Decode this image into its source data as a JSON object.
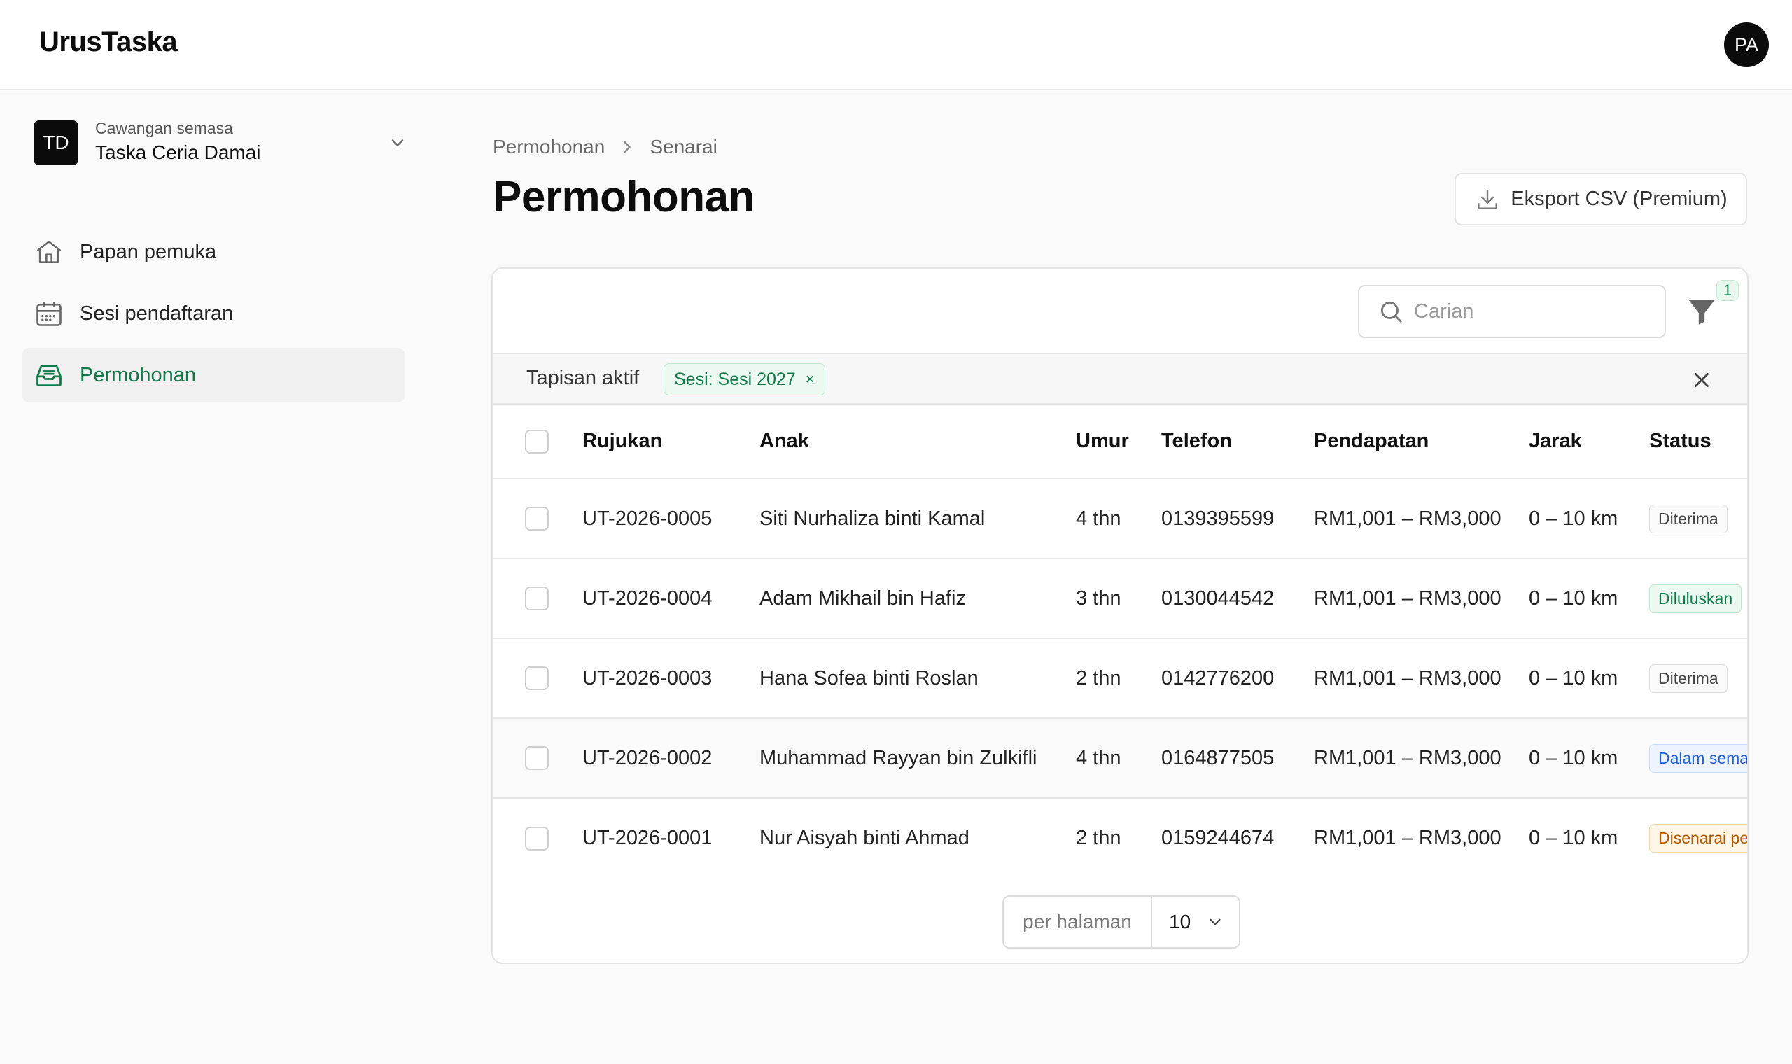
{
  "app": {
    "title": "UrusTaska",
    "user_initials": "PA"
  },
  "branch": {
    "initials": "TD",
    "caption": "Cawangan semasa",
    "name": "Taska Ceria Damai"
  },
  "sidebar": {
    "items": [
      {
        "label": "Papan pemuka",
        "icon": "home-icon"
      },
      {
        "label": "Sesi pendaftaran",
        "icon": "calendar-icon"
      },
      {
        "label": "Permohonan",
        "icon": "inbox-icon",
        "active": true
      }
    ]
  },
  "breadcrumb": {
    "parent": "Permohonan",
    "current": "Senarai"
  },
  "page": {
    "title": "Permohonan",
    "export_label": "Eksport CSV (Premium)"
  },
  "search": {
    "placeholder": "Carian"
  },
  "filters": {
    "count": "1",
    "label": "Tapisan aktif",
    "chips": [
      {
        "label": "Sesi: Sesi 2027",
        "remove": "×"
      }
    ]
  },
  "table": {
    "columns": [
      "Rujukan",
      "Anak",
      "Umur",
      "Telefon",
      "Pendapatan",
      "Jarak",
      "Status"
    ],
    "rows": [
      {
        "ref": "UT-2026-0005",
        "child": "Siti Nurhaliza binti Kamal",
        "age": "4 thn",
        "phone": "0139395599",
        "income": "RM1,001 – RM3,000",
        "distance": "0 – 10 km",
        "status": "Diterima",
        "status_color": "#444444"
      },
      {
        "ref": "UT-2026-0004",
        "child": "Adam Mikhail bin Hafiz",
        "age": "3 thn",
        "phone": "0130044542",
        "income": "RM1,001 – RM3,000",
        "distance": "0 – 10 km",
        "status": "Diluluskan",
        "status_color": "#0f7a4a"
      },
      {
        "ref": "UT-2026-0003",
        "child": "Hana Sofea binti Roslan",
        "age": "2 thn",
        "phone": "0142776200",
        "income": "RM1,001 – RM3,000",
        "distance": "0 – 10 km",
        "status": "Diterima",
        "status_color": "#444444"
      },
      {
        "ref": "UT-2026-0002",
        "child": "Muhammad Rayyan bin Zulkifli",
        "age": "4 thn",
        "phone": "0164877505",
        "income": "RM1,001 – RM3,000",
        "distance": "0 – 10 km",
        "status": "Dalam sema",
        "status_color": "#1f5fd0"
      },
      {
        "ref": "UT-2026-0001",
        "child": "Nur Aisyah binti Ahmad",
        "age": "2 thn",
        "phone": "0159244674",
        "income": "RM1,001 – RM3,000",
        "distance": "0 – 10 km",
        "status": "Disenarai pe",
        "status_color": "#b35a00"
      }
    ]
  },
  "pagination": {
    "per_page_label": "per halaman",
    "per_page_value": "10"
  },
  "colors": {
    "accent": "#0f7a4a",
    "dark": "#0b0b0b",
    "border": "#e4e4e4"
  }
}
